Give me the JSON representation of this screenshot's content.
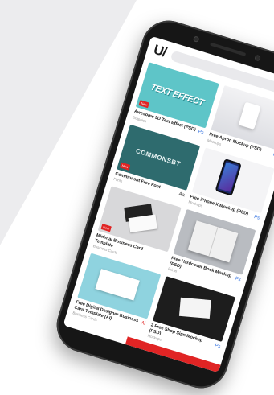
{
  "app": {
    "logo": "U/"
  },
  "search": {
    "placeholder": ""
  },
  "cards": [
    {
      "title": "Awesome 3D Text Effect (PSD)",
      "sub": "Graphics",
      "badge": "New",
      "thumb_text": "TEXT EFFECT",
      "icon": "photoshop-icon"
    },
    {
      "title": "Free Apron Mockup (PSD)",
      "sub": "Mockups",
      "badge": "",
      "thumb_text": "",
      "icon": "photoshop-icon"
    },
    {
      "title": "Commonsbt Free Font",
      "sub": "Fonts",
      "badge": "New",
      "thumb_text": "COMMONSBT",
      "icon": "font-icon"
    },
    {
      "title": "Free iPhone X Mockup (PSD)",
      "sub": "Mockups",
      "badge": "",
      "thumb_text": "",
      "icon": "photoshop-icon"
    },
    {
      "title": "Minimal Business Card Template",
      "sub": "Business Cards",
      "badge": "New",
      "thumb_text": "",
      "icon": ""
    },
    {
      "title": "Free Hardcover Book Mockup (PSD)",
      "sub": "Prints",
      "badge": "",
      "thumb_text": "",
      "icon": "photoshop-icon"
    },
    {
      "title": "Free Digital Designer Business Card Template (AI)",
      "sub": "Business Cards",
      "badge": "",
      "thumb_text": "",
      "icon": "illustrator-icon"
    },
    {
      "title": "2 Free Shop Sign Mockup (PSD)",
      "sub": "Mockups",
      "badge": "",
      "thumb_text": "",
      "icon": "photoshop-icon"
    }
  ]
}
